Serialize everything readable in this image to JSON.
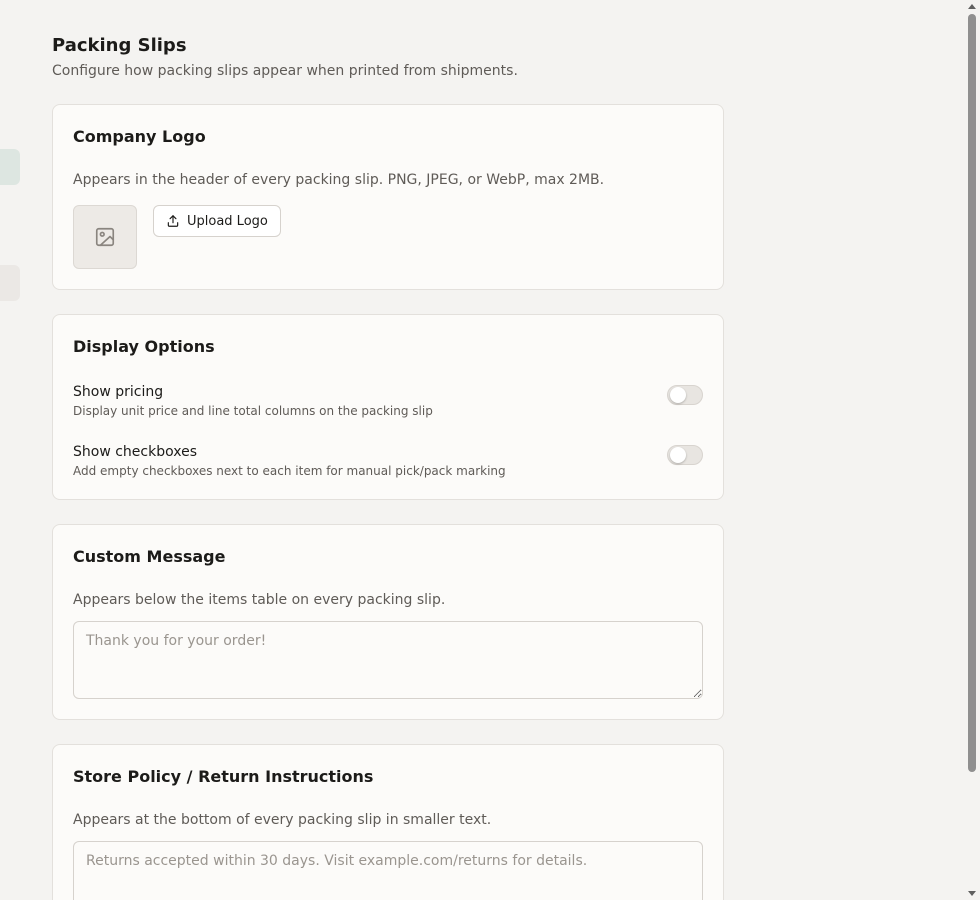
{
  "page": {
    "title": "Packing Slips",
    "subtitle": "Configure how packing slips appear when printed from shipments."
  },
  "logo_card": {
    "title": "Company Logo",
    "description": "Appears in the header of every packing slip. PNG, JPEG, or WebP, max 2MB.",
    "placeholder_icon": "image-placeholder-icon",
    "upload_label": "Upload Logo",
    "upload_icon": "upload-icon"
  },
  "display_card": {
    "title": "Display Options",
    "options": [
      {
        "label": "Show pricing",
        "help": "Display unit price and line total columns on the packing slip",
        "enabled": false
      },
      {
        "label": "Show checkboxes",
        "help": "Add empty checkboxes next to each item for manual pick/pack marking",
        "enabled": false
      }
    ]
  },
  "message_card": {
    "title": "Custom Message",
    "description": "Appears below the items table on every packing slip.",
    "placeholder": "Thank you for your order!",
    "value": ""
  },
  "policy_card": {
    "title": "Store Policy / Return Instructions",
    "description": "Appears at the bottom of every packing slip in smaller text.",
    "placeholder": "Returns accepted within 30 days. Visit example.com/returns for details.",
    "value": ""
  }
}
